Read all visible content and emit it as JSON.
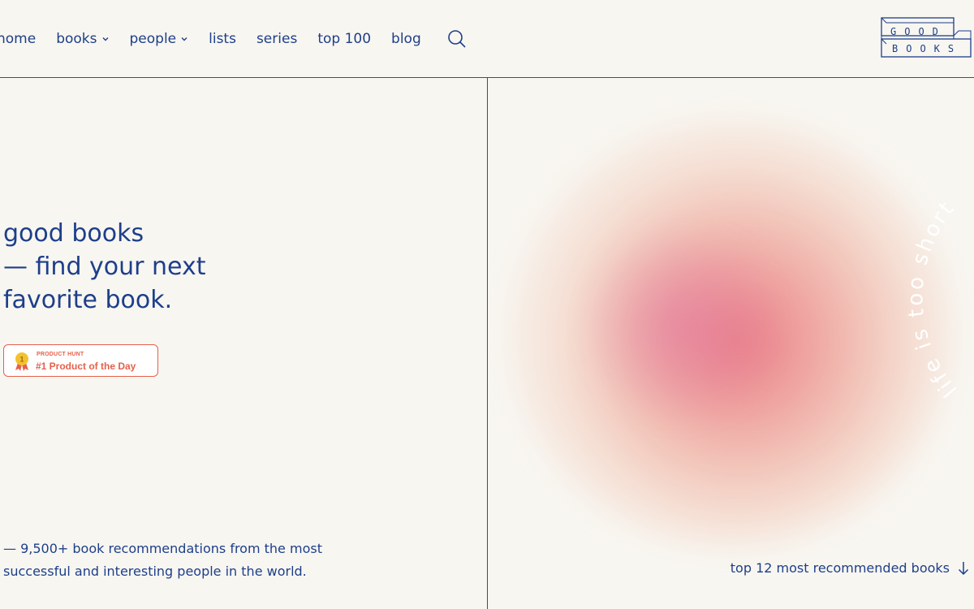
{
  "nav": {
    "items": [
      {
        "label": "home",
        "dropdown": false
      },
      {
        "label": "books",
        "dropdown": true
      },
      {
        "label": "people",
        "dropdown": true
      },
      {
        "label": "lists",
        "dropdown": false
      },
      {
        "label": "series",
        "dropdown": false
      },
      {
        "label": "top 100",
        "dropdown": false
      },
      {
        "label": "blog",
        "dropdown": false
      }
    ],
    "search_icon": "search-icon"
  },
  "logo": {
    "line1": "GOOD",
    "line2": "BOOKS"
  },
  "hero": {
    "headline_line1": "good books",
    "headline_line2": "— find your next",
    "headline_line3": "favorite book.",
    "badge_small": "PRODUCT HUNT",
    "badge_big": "#1 Product of the Day",
    "badge_medal_number": "1",
    "tagline_line1": "— 9,500+ book recommendations from the most",
    "tagline_line2": "successful and interesting people in the world."
  },
  "right": {
    "arc_text": "life is too short",
    "top_link": "top 12 most recommended books"
  },
  "colors": {
    "primary": "#1d3f8a",
    "accent": "#e6604b",
    "background": "#f8f6f1"
  }
}
